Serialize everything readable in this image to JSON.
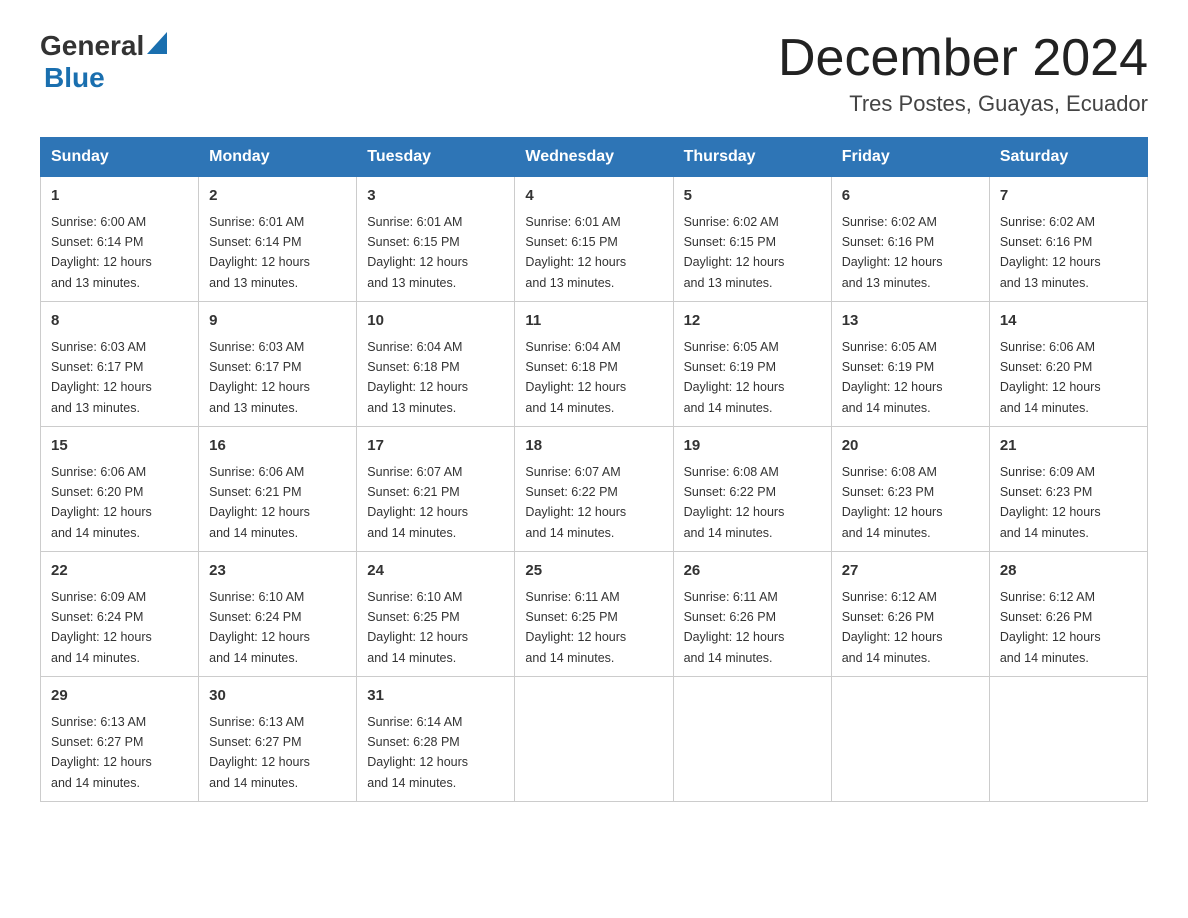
{
  "header": {
    "logo_general": "General",
    "logo_blue": "Blue",
    "month_title": "December 2024",
    "location": "Tres Postes, Guayas, Ecuador"
  },
  "days_of_week": [
    "Sunday",
    "Monday",
    "Tuesday",
    "Wednesday",
    "Thursday",
    "Friday",
    "Saturday"
  ],
  "weeks": [
    [
      {
        "day": "1",
        "sunrise": "6:00 AM",
        "sunset": "6:14 PM",
        "daylight": "12 hours and 13 minutes."
      },
      {
        "day": "2",
        "sunrise": "6:01 AM",
        "sunset": "6:14 PM",
        "daylight": "12 hours and 13 minutes."
      },
      {
        "day": "3",
        "sunrise": "6:01 AM",
        "sunset": "6:15 PM",
        "daylight": "12 hours and 13 minutes."
      },
      {
        "day": "4",
        "sunrise": "6:01 AM",
        "sunset": "6:15 PM",
        "daylight": "12 hours and 13 minutes."
      },
      {
        "day": "5",
        "sunrise": "6:02 AM",
        "sunset": "6:15 PM",
        "daylight": "12 hours and 13 minutes."
      },
      {
        "day": "6",
        "sunrise": "6:02 AM",
        "sunset": "6:16 PM",
        "daylight": "12 hours and 13 minutes."
      },
      {
        "day": "7",
        "sunrise": "6:02 AM",
        "sunset": "6:16 PM",
        "daylight": "12 hours and 13 minutes."
      }
    ],
    [
      {
        "day": "8",
        "sunrise": "6:03 AM",
        "sunset": "6:17 PM",
        "daylight": "12 hours and 13 minutes."
      },
      {
        "day": "9",
        "sunrise": "6:03 AM",
        "sunset": "6:17 PM",
        "daylight": "12 hours and 13 minutes."
      },
      {
        "day": "10",
        "sunrise": "6:04 AM",
        "sunset": "6:18 PM",
        "daylight": "12 hours and 13 minutes."
      },
      {
        "day": "11",
        "sunrise": "6:04 AM",
        "sunset": "6:18 PM",
        "daylight": "12 hours and 14 minutes."
      },
      {
        "day": "12",
        "sunrise": "6:05 AM",
        "sunset": "6:19 PM",
        "daylight": "12 hours and 14 minutes."
      },
      {
        "day": "13",
        "sunrise": "6:05 AM",
        "sunset": "6:19 PM",
        "daylight": "12 hours and 14 minutes."
      },
      {
        "day": "14",
        "sunrise": "6:06 AM",
        "sunset": "6:20 PM",
        "daylight": "12 hours and 14 minutes."
      }
    ],
    [
      {
        "day": "15",
        "sunrise": "6:06 AM",
        "sunset": "6:20 PM",
        "daylight": "12 hours and 14 minutes."
      },
      {
        "day": "16",
        "sunrise": "6:06 AM",
        "sunset": "6:21 PM",
        "daylight": "12 hours and 14 minutes."
      },
      {
        "day": "17",
        "sunrise": "6:07 AM",
        "sunset": "6:21 PM",
        "daylight": "12 hours and 14 minutes."
      },
      {
        "day": "18",
        "sunrise": "6:07 AM",
        "sunset": "6:22 PM",
        "daylight": "12 hours and 14 minutes."
      },
      {
        "day": "19",
        "sunrise": "6:08 AM",
        "sunset": "6:22 PM",
        "daylight": "12 hours and 14 minutes."
      },
      {
        "day": "20",
        "sunrise": "6:08 AM",
        "sunset": "6:23 PM",
        "daylight": "12 hours and 14 minutes."
      },
      {
        "day": "21",
        "sunrise": "6:09 AM",
        "sunset": "6:23 PM",
        "daylight": "12 hours and 14 minutes."
      }
    ],
    [
      {
        "day": "22",
        "sunrise": "6:09 AM",
        "sunset": "6:24 PM",
        "daylight": "12 hours and 14 minutes."
      },
      {
        "day": "23",
        "sunrise": "6:10 AM",
        "sunset": "6:24 PM",
        "daylight": "12 hours and 14 minutes."
      },
      {
        "day": "24",
        "sunrise": "6:10 AM",
        "sunset": "6:25 PM",
        "daylight": "12 hours and 14 minutes."
      },
      {
        "day": "25",
        "sunrise": "6:11 AM",
        "sunset": "6:25 PM",
        "daylight": "12 hours and 14 minutes."
      },
      {
        "day": "26",
        "sunrise": "6:11 AM",
        "sunset": "6:26 PM",
        "daylight": "12 hours and 14 minutes."
      },
      {
        "day": "27",
        "sunrise": "6:12 AM",
        "sunset": "6:26 PM",
        "daylight": "12 hours and 14 minutes."
      },
      {
        "day": "28",
        "sunrise": "6:12 AM",
        "sunset": "6:26 PM",
        "daylight": "12 hours and 14 minutes."
      }
    ],
    [
      {
        "day": "29",
        "sunrise": "6:13 AM",
        "sunset": "6:27 PM",
        "daylight": "12 hours and 14 minutes."
      },
      {
        "day": "30",
        "sunrise": "6:13 AM",
        "sunset": "6:27 PM",
        "daylight": "12 hours and 14 minutes."
      },
      {
        "day": "31",
        "sunrise": "6:14 AM",
        "sunset": "6:28 PM",
        "daylight": "12 hours and 14 minutes."
      },
      null,
      null,
      null,
      null
    ]
  ]
}
